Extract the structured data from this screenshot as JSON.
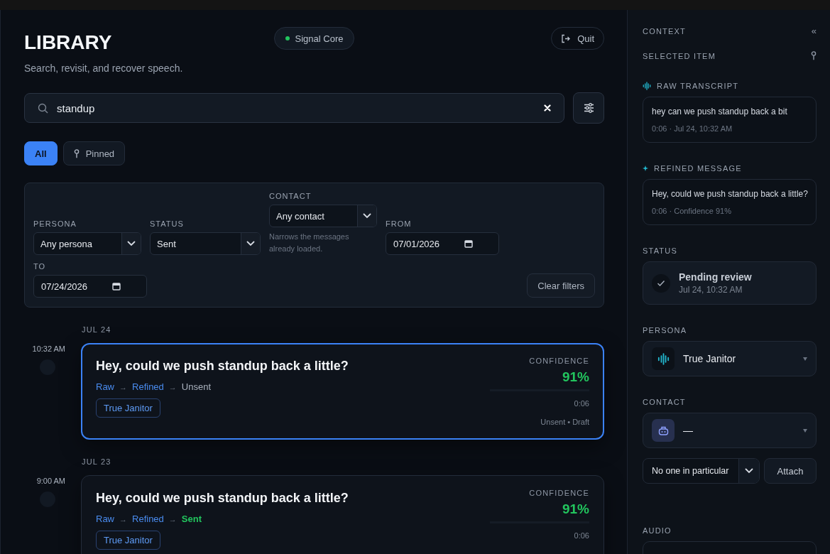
{
  "header": {
    "title": "LIBRARY",
    "subtitle": "Search, revisit, and recover speech.",
    "engine": {
      "label": "Signal Core",
      "color": "#22c55e"
    },
    "quit_button": "Quit"
  },
  "search": {
    "value": "standup"
  },
  "scope_tabs": [
    {
      "label": "All",
      "selected": true,
      "kind": "plain"
    },
    {
      "label": "Pinned",
      "selected": false,
      "kind": "pin"
    }
  ],
  "filters": {
    "fields": [
      {
        "label": "PERSONA",
        "kind": "select",
        "value": "Any persona"
      },
      {
        "label": "STATUS",
        "kind": "select",
        "value": "Sent"
      },
      {
        "label": "CONTACT",
        "kind": "select",
        "value": "Any contact",
        "hint": "Narrows the messages already loaded."
      },
      {
        "label": "FROM",
        "kind": "date",
        "value": "07/01/2026"
      },
      {
        "label": "TO",
        "kind": "date",
        "value": "07/24/2026"
      }
    ],
    "clear_button": "Clear filters"
  },
  "timeline": [
    {
      "date": "JUL 24",
      "time": "10:32 AM",
      "selected": true,
      "title": "Hey, could we push standup back a little?",
      "steps": [
        {
          "label": "Raw",
          "kind": "link"
        },
        {
          "label": "Refined",
          "kind": "link"
        },
        {
          "label": "Unsent",
          "kind": "pending"
        }
      ],
      "separator": "→",
      "tag": "True Janitor",
      "confidence_label": "CONFIDENCE",
      "confidence": "91%",
      "duration": "0:06",
      "status": "Unsent • Draft"
    },
    {
      "date": "JUL 23",
      "time": "9:00 AM",
      "selected": false,
      "title": "Hey, could we push standup back a little?",
      "steps": [
        {
          "label": "Raw",
          "kind": "link"
        },
        {
          "label": "Refined",
          "kind": "link"
        },
        {
          "label": "Sent",
          "kind": "sent"
        }
      ],
      "separator": "→",
      "tag": "True Janitor",
      "confidence_label": "CONFIDENCE",
      "confidence": "91%",
      "duration": "0:06"
    }
  ],
  "context": {
    "title": "CONTEXT",
    "collapse": "«",
    "selected_label": "SELECTED ITEM",
    "raw": {
      "label": "RAW TRANSCRIPT",
      "text": "hey can we push standup back a bit",
      "meta": "0:06 · Jul 24, 10:32 AM"
    },
    "refined": {
      "label": "REFINED MESSAGE",
      "text": "Hey, could we push standup back a little?",
      "meta": "0:06 · Confidence 91%"
    },
    "status": {
      "label": "STATUS",
      "title": "Pending review",
      "time": "Jul 24, 10:32 AM"
    },
    "persona": {
      "label": "PERSONA",
      "value": "True Janitor"
    },
    "contact": {
      "label": "CONTACT",
      "value": "—",
      "select": "No one in particular",
      "attach_button": "Attach"
    },
    "audio": {
      "label": "AUDIO"
    }
  }
}
